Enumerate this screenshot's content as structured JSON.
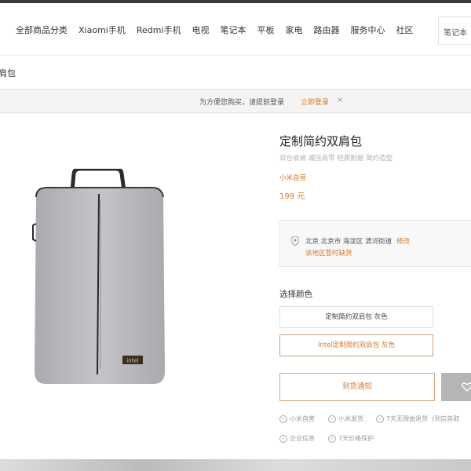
{
  "header": {
    "nav": [
      "全部商品分类",
      "Xiaomi手机",
      "Redmi手机",
      "电视",
      "笔记本",
      "平板",
      "家电",
      "路由器",
      "服务中心",
      "社区"
    ],
    "search_placeholder": "笔记本"
  },
  "breadcrumb": {
    "label": "肩包"
  },
  "notice": {
    "text": "为方便您购买，请提前登录",
    "login": "立即登录",
    "close": "×"
  },
  "product": {
    "title": "定制简约双肩包",
    "subtitle": "双仓收纳 减压肩带 轻质耐磨 简约造型",
    "tag": "小米自营",
    "price": "199 元",
    "bag_logo": "intel",
    "address": {
      "line1": "北京  北京市  海淀区  清河街道",
      "edit": "修改",
      "stock": "该地区暂时缺货"
    },
    "color_label": "选择颜色",
    "options": [
      "定制简约双肩包 灰色",
      "Intel定制简约双肩包 灰色"
    ],
    "selected_option_index": 1,
    "notify_button": "到货通知",
    "services": [
      "小米自营",
      "小米发货",
      "7天无理由退货",
      "(到店自取",
      "企业信息",
      "7天价格保护"
    ]
  },
  "colors": {
    "accent": "#d67a2c",
    "gray_button": "#b5b5b5"
  }
}
